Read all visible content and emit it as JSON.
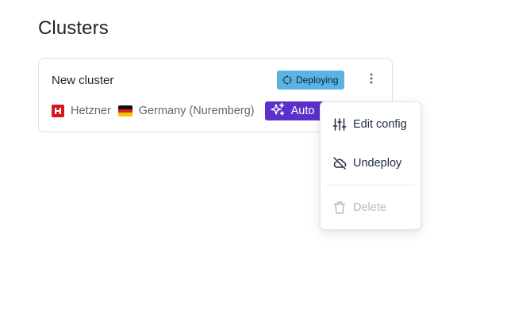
{
  "page": {
    "title": "Clusters"
  },
  "cluster": {
    "name": "New cluster",
    "status": "Deploying",
    "provider": "Hetzner",
    "region": "Germany (Nuremberg)",
    "mode_badge": "Auto"
  },
  "menu": {
    "items": [
      {
        "label": "Edit config",
        "icon": "sliders-icon",
        "enabled": true
      },
      {
        "label": "Undeploy",
        "icon": "cloud-off-icon",
        "enabled": true
      },
      {
        "label": "Delete",
        "icon": "trash-icon",
        "enabled": false
      }
    ]
  },
  "colors": {
    "status_badge": "#5bb3e3",
    "auto_badge": "#5a32c9",
    "provider_logo": "#d5161f"
  }
}
